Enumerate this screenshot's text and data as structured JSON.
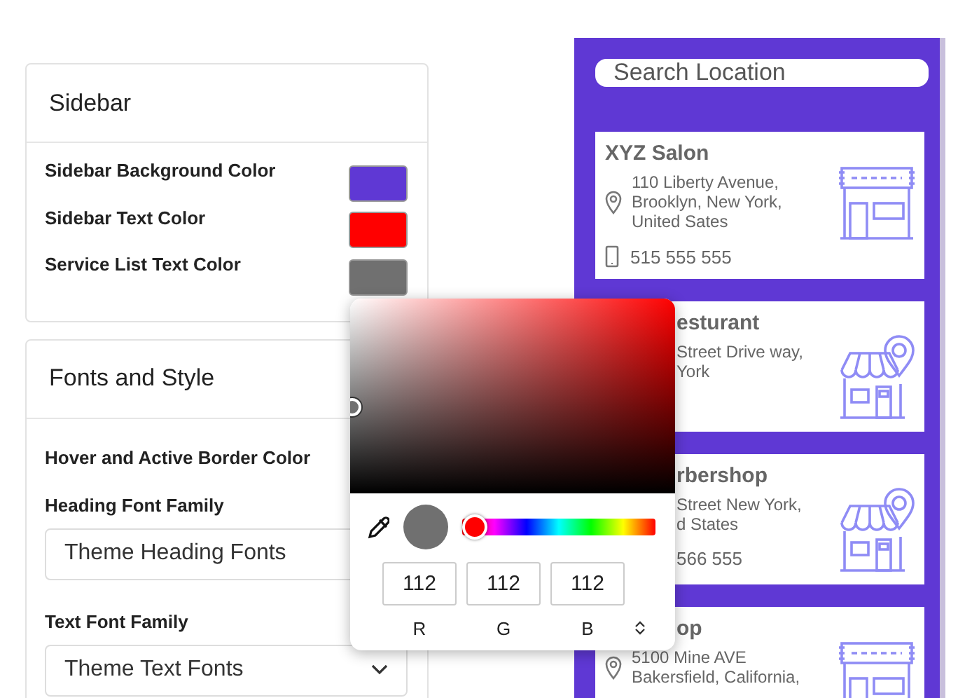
{
  "sidebar_settings": {
    "title": "Sidebar",
    "colors": [
      {
        "label": "Sidebar Background Color",
        "color": "#5f38d4"
      },
      {
        "label": "Sidebar Text Color",
        "color": "#ff0000"
      },
      {
        "label": "Service List Text Color",
        "color": "#707070"
      }
    ]
  },
  "fonts_settings": {
    "title": "Fonts and Style",
    "border_label": "Hover and Active Border Color",
    "fields": [
      {
        "label": "Heading Font Family",
        "value": "Theme Heading Fonts"
      },
      {
        "label": "Text Font Family",
        "value": "Theme Text Fonts"
      }
    ]
  },
  "color_picker": {
    "color": "#707070",
    "level": 0,
    "channels": [
      {
        "label": "R",
        "value": "112"
      },
      {
        "label": "G",
        "value": "112"
      },
      {
        "label": "B",
        "value": "112"
      }
    ]
  },
  "preview": {
    "search": {
      "placeholder": "Search Location"
    },
    "locations": [
      {
        "title": "XYZ Salon",
        "address": [
          "110 Liberty Avenue,",
          "Brooklyn, New York,",
          "United Sates"
        ],
        "phone": "515 555 555",
        "kind": "salon"
      },
      {
        "title": "esturant",
        "address": [
          "Street Drive way,",
          "York"
        ],
        "kind": "market"
      },
      {
        "title": "rbershop",
        "address": [
          "Street New York,",
          "d States"
        ],
        "phone": "566 555",
        "kind": "market"
      },
      {
        "title": "op",
        "address": [
          "5100 Mine AVE",
          "Bakersfield, California,"
        ],
        "kind": "salon"
      }
    ]
  }
}
